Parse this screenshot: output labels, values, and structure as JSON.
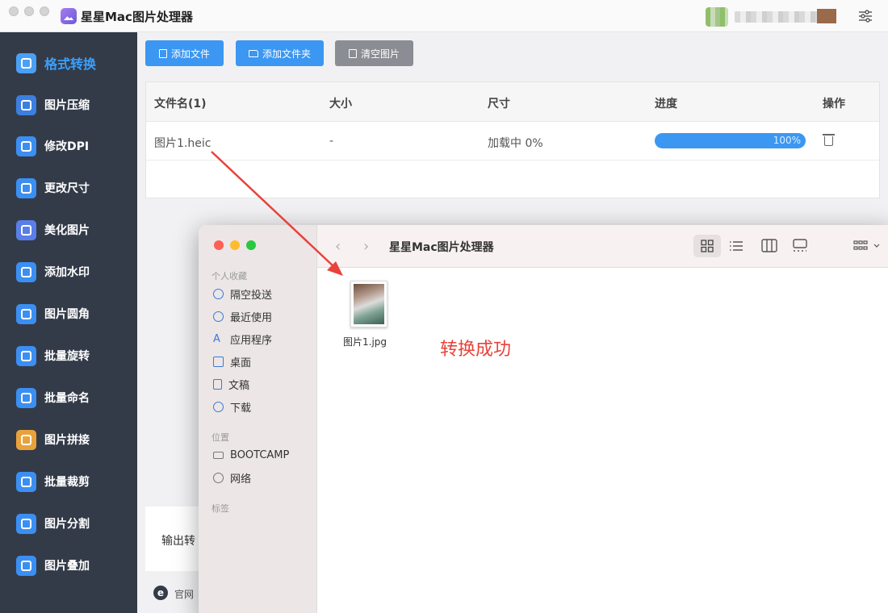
{
  "app": {
    "title": "星星Mac图片处理器"
  },
  "sidebar": {
    "items": [
      {
        "label": "格式转换",
        "color": "#4aa0f5",
        "active": true
      },
      {
        "label": "图片压缩",
        "color": "#3b7fe0"
      },
      {
        "label": "修改DPI",
        "color": "#3b8ff2"
      },
      {
        "label": "更改尺寸",
        "color": "#3b8ff2"
      },
      {
        "label": "美化图片",
        "color": "#5a7ee8"
      },
      {
        "label": "添加水印",
        "color": "#3b8ff2"
      },
      {
        "label": "图片圆角",
        "color": "#3b8ff2"
      },
      {
        "label": "批量旋转",
        "color": "#3b8ff2"
      },
      {
        "label": "批量命名",
        "color": "#3b8ff2"
      },
      {
        "label": "图片拼接",
        "color": "#e9a23b"
      },
      {
        "label": "批量裁剪",
        "color": "#3b8ff2"
      },
      {
        "label": "图片分割",
        "color": "#3b8ff2"
      },
      {
        "label": "图片叠加",
        "color": "#3b8ff2"
      }
    ]
  },
  "toolbar": {
    "add_file": "添加文件",
    "add_folder": "添加文件夹",
    "clear_images": "清空图片"
  },
  "table": {
    "headers": [
      "文件名(1)",
      "大小",
      "尺寸",
      "进度",
      "操作"
    ],
    "rows": [
      {
        "name": "图片1.heic",
        "size": "-",
        "dimensions": "加载中 0%",
        "progress": 1.0,
        "progress_label": "100%"
      }
    ]
  },
  "output": {
    "label": "输出转"
  },
  "footer": {
    "website": "官网",
    "logo_letter": "e"
  },
  "finder": {
    "title": "星星Mac图片处理器",
    "sections": [
      {
        "title": "个人收藏",
        "items": [
          "隔空投送",
          "最近使用",
          "应用程序",
          "桌面",
          "文稿",
          "下载"
        ]
      },
      {
        "title": "位置",
        "items": [
          "BOOTCAMP",
          "网络"
        ]
      },
      {
        "title": "标签",
        "items": []
      }
    ],
    "file": {
      "name": "图片1.jpg"
    }
  },
  "annotation": {
    "text": "转换成功",
    "color": "#e8423a"
  }
}
